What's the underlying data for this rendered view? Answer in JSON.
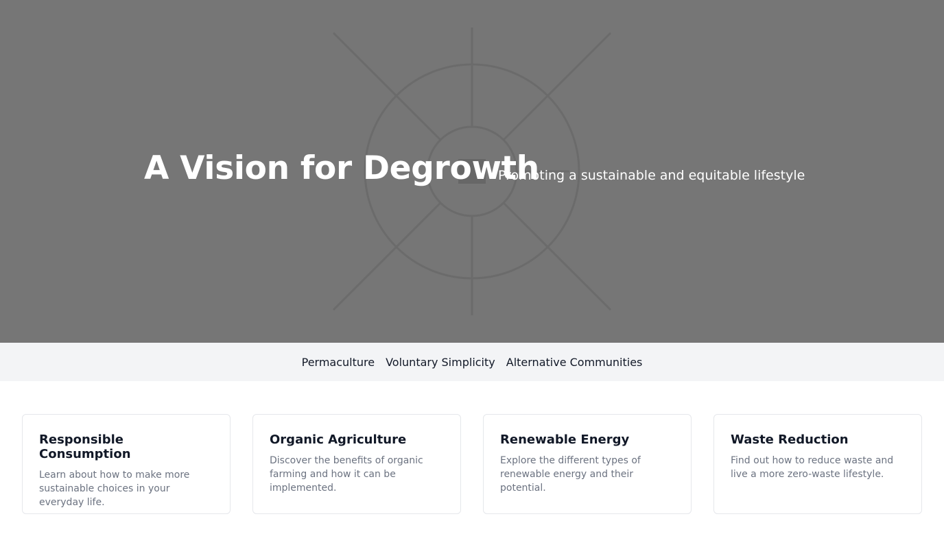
{
  "hero": {
    "title": "A Vision for Degrowth",
    "subtitle": "Promoting a sustainable and equitable lifestyle",
    "background_color": "#767676",
    "text_color": "#ffffff",
    "background_art_icon": "sun-wheel-icon"
  },
  "nav": {
    "background_color": "#f3f4f6",
    "items": [
      {
        "label": "Permaculture"
      },
      {
        "label": "Voluntary Simplicity"
      },
      {
        "label": "Alternative Communities"
      }
    ]
  },
  "cards": [
    {
      "title": "Responsible Consumption",
      "description": "Learn about how to make more sustainable choices in your everyday life."
    },
    {
      "title": "Organic Agriculture",
      "description": "Discover the benefits of organic farming and how it can be implemented."
    },
    {
      "title": "Renewable Energy",
      "description": "Explore the different types of renewable energy and their potential."
    },
    {
      "title": "Waste Reduction",
      "description": "Find out how to reduce waste and live a more zero-waste lifestyle."
    }
  ]
}
